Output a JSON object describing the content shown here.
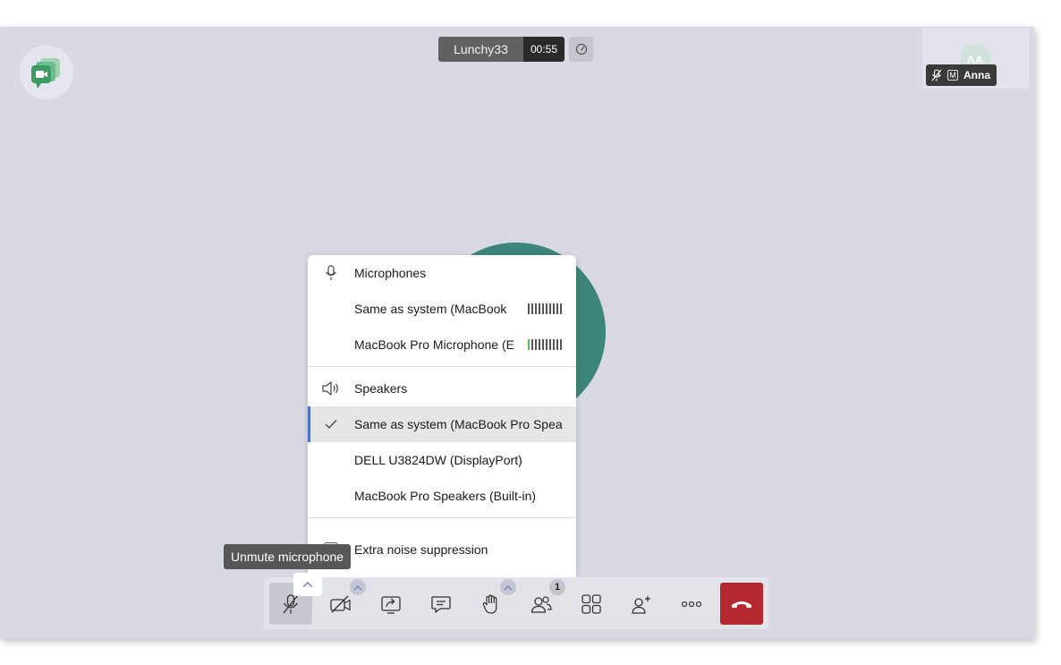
{
  "header": {
    "room_name": "Lunchy33",
    "timer": "00:55"
  },
  "participant_thumbnail": {
    "initials": "AA",
    "moderator_badge": "M",
    "name": "Anna"
  },
  "audio_menu": {
    "microphones_heading": "Microphones",
    "microphones": [
      {
        "label": "Same as system (MacBook",
        "level_active_bars": 0
      },
      {
        "label": "MacBook Pro Microphone (E",
        "level_active_bars": 1
      }
    ],
    "speakers_heading": "Speakers",
    "speakers": [
      {
        "label": "Same as system (MacBook Pro Spea",
        "selected": true
      },
      {
        "label": "DELL U3824DW (DisplayPort)",
        "selected": false
      },
      {
        "label": "MacBook Pro Speakers (Built-in)",
        "selected": false
      }
    ],
    "noise_suppression_label": "Extra noise suppression"
  },
  "tooltip": {
    "text": "Unmute microphone"
  },
  "toolbar": {
    "participants_count": "1"
  },
  "colors": {
    "stage_background": "#d8d9e3",
    "avatar_teal": "#3d8479",
    "hangup_red": "#b3292f",
    "selection_accent": "#4d72c9",
    "level_active": "#5cb85c"
  }
}
